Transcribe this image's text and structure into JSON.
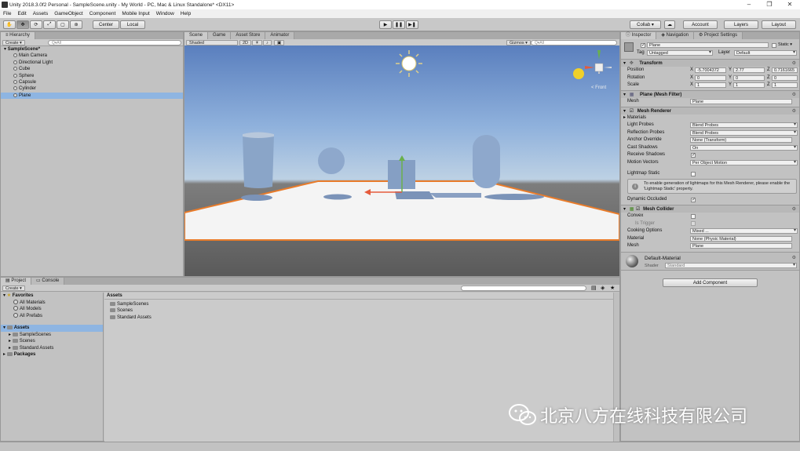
{
  "window": {
    "title": "Unity 2018.3.0f2 Personal - SampleScene.unity - My World - PC, Mac & Linux Standalone* <DX11>"
  },
  "menu": [
    "File",
    "Edit",
    "Assets",
    "GameObject",
    "Component",
    "Mobile Input",
    "Window",
    "Help"
  ],
  "toolbar": {
    "center": "Center",
    "local": "Local",
    "collab": "Collab ▾",
    "account": "Account",
    "layers": "Layers",
    "layout": "Layout"
  },
  "hierarchy": {
    "tab": "Hierarchy",
    "create": "Create",
    "search": "Q▾All",
    "scene": "SampleScene*",
    "items": [
      {
        "label": "Main Camera",
        "selected": false
      },
      {
        "label": "Directional Light",
        "selected": false
      },
      {
        "label": "Cube",
        "selected": false
      },
      {
        "label": "Sphere",
        "selected": false
      },
      {
        "label": "Capsule",
        "selected": false
      },
      {
        "label": "Cylinder",
        "selected": false
      },
      {
        "label": "Plane",
        "selected": true
      }
    ]
  },
  "scene": {
    "tabs": [
      "Scene",
      "Game",
      "Asset Store",
      "Animator"
    ],
    "shading": "Shaded",
    "mode2d": "2D",
    "gizmos": "Gizmos ▾",
    "search": "Q▾All",
    "persp_label": "< Front"
  },
  "inspector": {
    "tabs": [
      "Inspector",
      "Navigation",
      "Project Settings"
    ],
    "object_name": "Plane",
    "static": "Static ▾",
    "tag_label": "Tag",
    "tag_value": "Untagged",
    "layer_label": "Layer",
    "layer_value": "Default",
    "transform": {
      "title": "Transform",
      "position": {
        "label": "Position",
        "x": "-5.7004372",
        "y": "2.77",
        "z": "0.7161665"
      },
      "rotation": {
        "label": "Rotation",
        "x": "0",
        "y": "0",
        "z": "0"
      },
      "scale": {
        "label": "Scale",
        "x": "1",
        "y": "1",
        "z": "1"
      }
    },
    "mesh_filter": {
      "title": "Plane (Mesh Filter)",
      "mesh_label": "Mesh",
      "mesh_value": "Plane"
    },
    "mesh_renderer": {
      "title": "Mesh Renderer",
      "materials": "Materials",
      "light_probes": {
        "label": "Light Probes",
        "value": "Blend Probes"
      },
      "reflection_probes": {
        "label": "Reflection Probes",
        "value": "Blend Probes"
      },
      "anchor_override": {
        "label": "Anchor Override",
        "value": "None (Transform)"
      },
      "cast_shadows": {
        "label": "Cast Shadows",
        "value": "On"
      },
      "receive_shadows": {
        "label": "Receive Shadows"
      },
      "motion_vectors": {
        "label": "Motion Vectors",
        "value": "Per Object Motion"
      },
      "lightmap_static": {
        "label": "Lightmap Static"
      },
      "info": "To enable generation of lightmaps for this Mesh Renderer, please enable the 'Lightmap Static' property.",
      "dynamic_occluded": {
        "label": "Dynamic Occluded"
      }
    },
    "mesh_collider": {
      "title": "Mesh Collider",
      "convex": {
        "label": "Convex"
      },
      "is_trigger": {
        "label": "Is Trigger"
      },
      "cooking": {
        "label": "Cooking Options",
        "value": "Mixed ..."
      },
      "material": {
        "label": "Material",
        "value": "None (Physic Material)"
      },
      "mesh": {
        "label": "Mesh",
        "value": "Plane"
      }
    },
    "material": {
      "name": "Default-Material",
      "shader_label": "Shader",
      "shader_value": "Standard"
    },
    "add_component": "Add Component"
  },
  "project": {
    "tabs": [
      "Project",
      "Console"
    ],
    "create": "Create",
    "favorites": "Favorites",
    "fav_items": [
      "All Materials",
      "All Models",
      "All Prefabs"
    ],
    "assets": "Assets",
    "asset_items": [
      "SampleScenes",
      "Scenes",
      "Standard Assets"
    ],
    "packages": "Packages",
    "breadcrumb": "Assets",
    "grid_items": [
      "SampleScenes",
      "Scenes",
      "Standard Assets"
    ]
  },
  "watermark": "北京八方在线科技有限公司",
  "colors": {
    "selection": "#8eb5e2",
    "plane_outline": "#e87b2a",
    "sky_top": "#5a7fbe"
  }
}
